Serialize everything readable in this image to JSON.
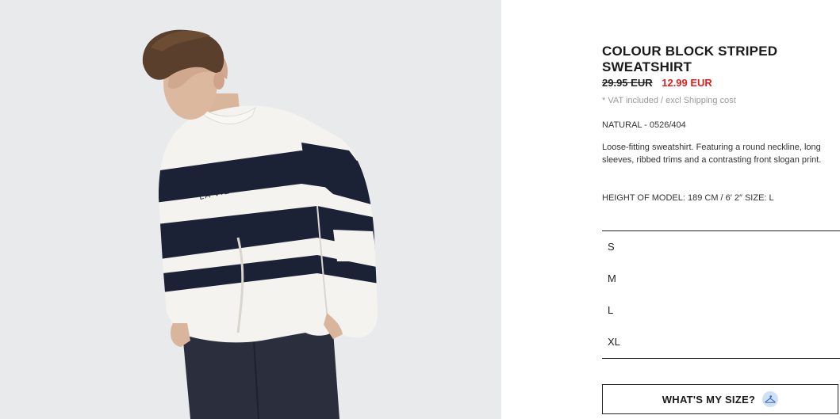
{
  "product": {
    "title": "COLOUR BLOCK STRIPED SWEATSHIRT",
    "old_price": "29.95 EUR",
    "new_price": "12.99 EUR",
    "vat_note": "* VAT included / excl Shipping cost",
    "color_ref": "NATURAL - 0526/404",
    "description": "Loose-fitting sweatshirt. Featuring a round neckline, long sleeves, ribbed trims and a contrasting front slogan print.",
    "model_info": "HEIGHT OF MODEL: 189 CM / 6′ 2″ SIZE: L",
    "print_slogan": "LA VIE ET LA NUIT"
  },
  "sizes": [
    "S",
    "M",
    "L",
    "XL"
  ],
  "size_guide": {
    "button_label": "WHAT'S MY SIZE?",
    "icon": "hanger-icon"
  },
  "colors": {
    "sale_price": "#e21f1f",
    "photo_background": "#e9eaec",
    "stripe_navy": "#1c2236",
    "garment_white": "#f4f3ef",
    "size_icon_bg": "#cfe0f4"
  }
}
